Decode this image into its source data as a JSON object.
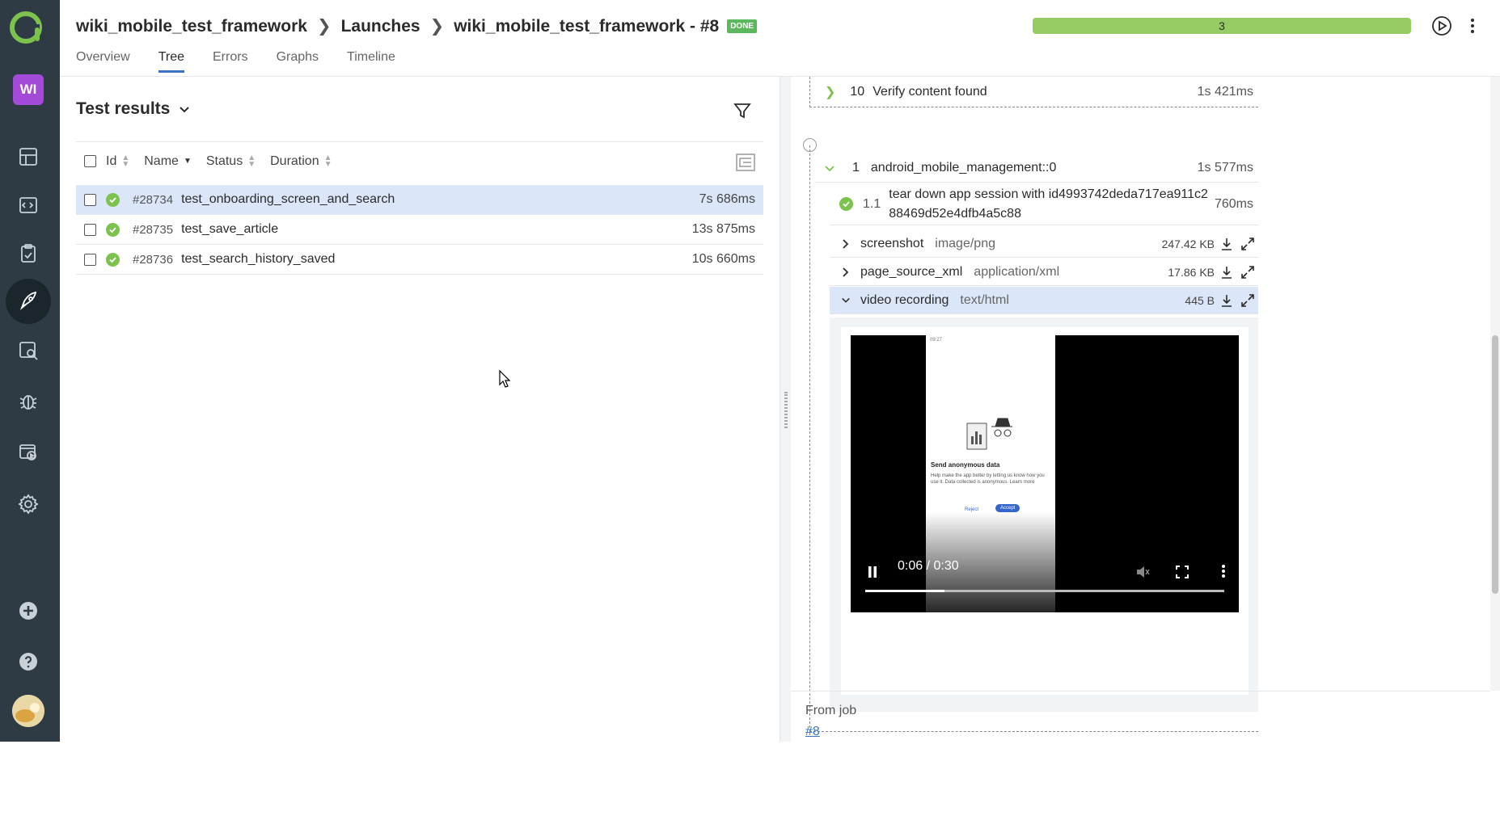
{
  "sidebar": {
    "workspace_initials": "WI"
  },
  "header": {
    "breadcrumbs": [
      "wiki_mobile_test_framework",
      "Launches",
      "wiki_mobile_test_framework - #8"
    ],
    "status_badge": "DONE",
    "progress_value": "3",
    "tabs": [
      "Overview",
      "Tree",
      "Errors",
      "Graphs",
      "Timeline"
    ],
    "active_tab": "Tree"
  },
  "results": {
    "title": "Test results",
    "columns": [
      "Id",
      "Name",
      "Status",
      "Duration"
    ],
    "rows": [
      {
        "id": "#28734",
        "name": "test_onboarding_screen_and_search",
        "duration": "7s 686ms",
        "selected": true
      },
      {
        "id": "#28735",
        "name": "test_save_article",
        "duration": "13s 875ms",
        "selected": false
      },
      {
        "id": "#28736",
        "name": "test_search_history_saved",
        "duration": "10s 660ms",
        "selected": false
      }
    ]
  },
  "detail": {
    "step10": {
      "num": "10",
      "name": "Verify content found",
      "duration": "1s 421ms"
    },
    "group": {
      "num": "1",
      "name": "android_mobile_management::0",
      "duration": "1s 577ms"
    },
    "substep": {
      "num": "1.1",
      "name": "tear down app session with id4993742deda717ea911c288469d52e4dfb4a5c88",
      "duration": "760ms"
    },
    "attachments": [
      {
        "name": "screenshot",
        "mime": "image/png",
        "size": "247.42 KB",
        "open": false
      },
      {
        "name": "page_source_xml",
        "mime": "application/xml",
        "size": "17.86 KB",
        "open": false
      },
      {
        "name": "video recording",
        "mime": "text/html",
        "size": "445 B",
        "open": true
      }
    ],
    "video": {
      "time": "0:06 / 0:30",
      "progress_fraction": 0.22,
      "screen_title": "Send anonymous data",
      "screen_text": "Help make the app better by letting us know how you use it. Data collected is anonymous. Learn more",
      "reject_label": "Reject",
      "accept_label": "Accept",
      "status_time": "09:27"
    },
    "from_job": {
      "label": "From job",
      "link": "#8"
    }
  },
  "colors": {
    "sidebar": "#2e3b44",
    "accent": "#3b73c4",
    "passed": "#7cc24d",
    "progress": "#97cc64",
    "selected_row": "#dbe7f8"
  }
}
